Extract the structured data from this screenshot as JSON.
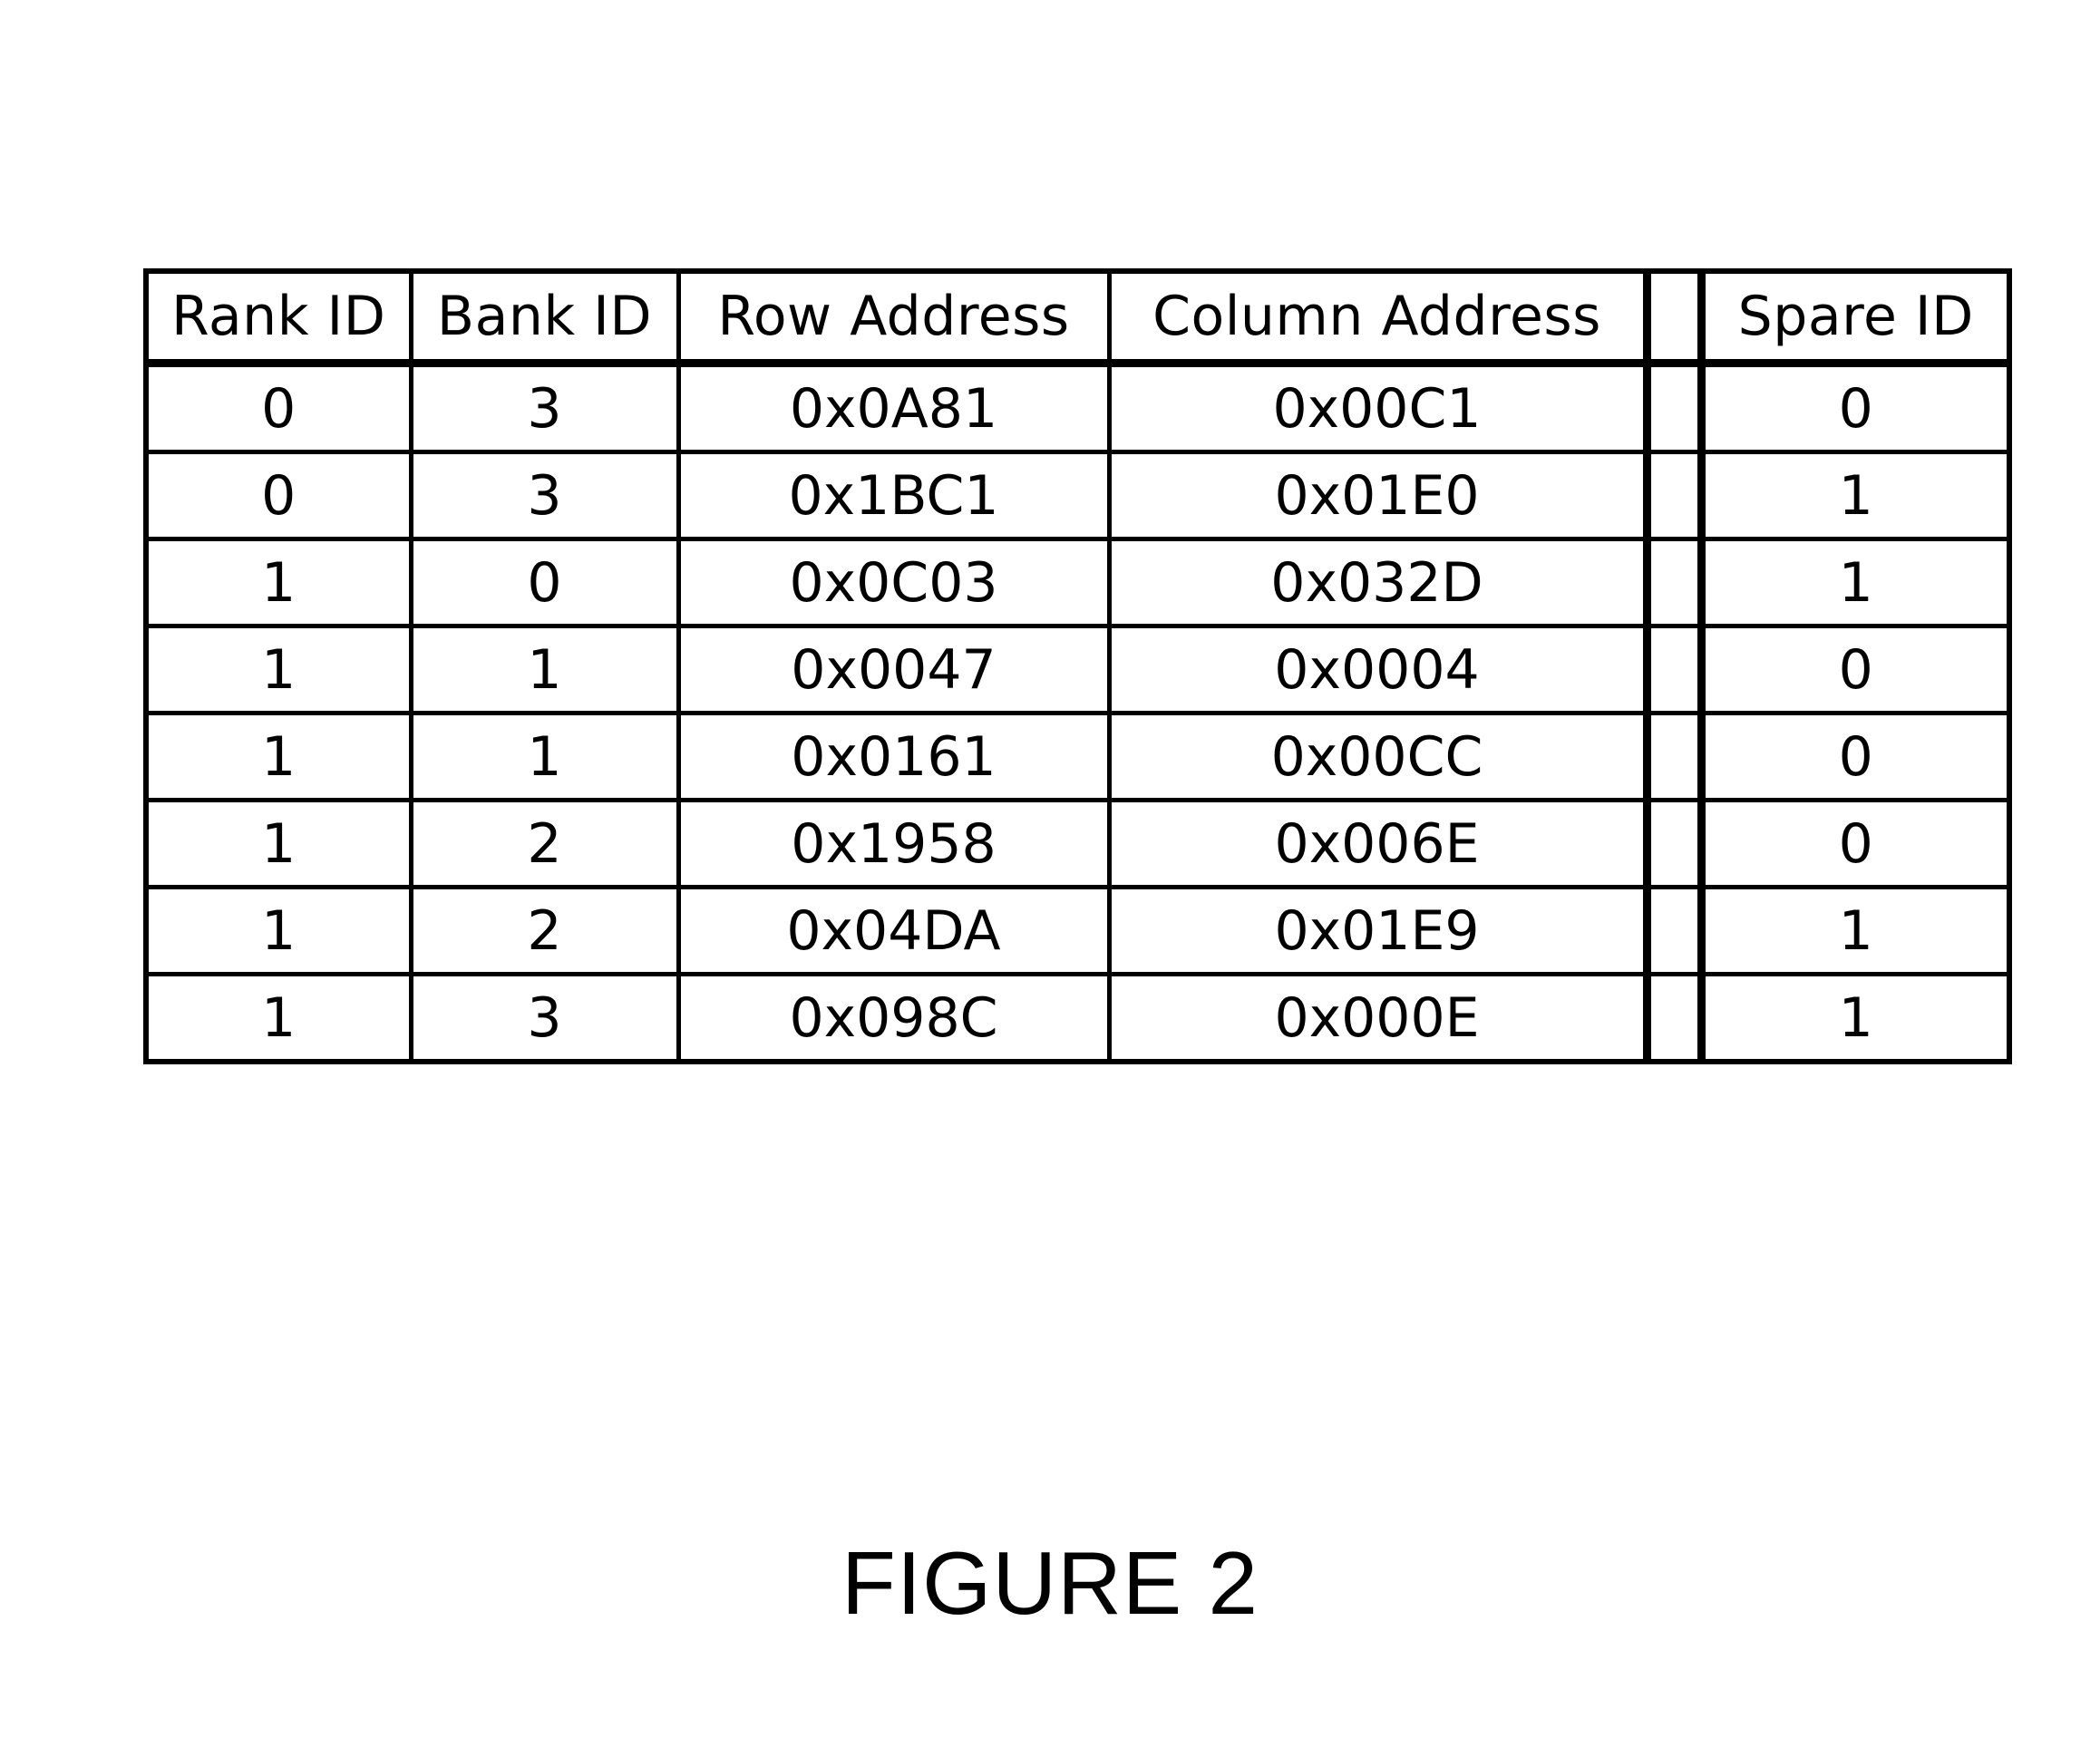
{
  "table": {
    "headers": [
      "Rank ID",
      "Bank ID",
      "Row Address",
      "Column Address",
      "",
      "Spare ID"
    ],
    "rows": [
      {
        "rank_id": "0",
        "bank_id": "3",
        "row_address": "0x0A81",
        "column_address": "0x00C1",
        "spare_id": "0"
      },
      {
        "rank_id": "0",
        "bank_id": "3",
        "row_address": "0x1BC1",
        "column_address": "0x01E0",
        "spare_id": "1"
      },
      {
        "rank_id": "1",
        "bank_id": "0",
        "row_address": "0x0C03",
        "column_address": "0x032D",
        "spare_id": "1"
      },
      {
        "rank_id": "1",
        "bank_id": "1",
        "row_address": "0x0047",
        "column_address": "0x0004",
        "spare_id": "0"
      },
      {
        "rank_id": "1",
        "bank_id": "1",
        "row_address": "0x0161",
        "column_address": "0x00CC",
        "spare_id": "0"
      },
      {
        "rank_id": "1",
        "bank_id": "2",
        "row_address": "0x1958",
        "column_address": "0x006E",
        "spare_id": "0"
      },
      {
        "rank_id": "1",
        "bank_id": "2",
        "row_address": "0x04DA",
        "column_address": "0x01E9",
        "spare_id": "1"
      },
      {
        "rank_id": "1",
        "bank_id": "3",
        "row_address": "0x098C",
        "column_address": "0x000E",
        "spare_id": "1"
      }
    ]
  },
  "caption": "FIGURE 2"
}
